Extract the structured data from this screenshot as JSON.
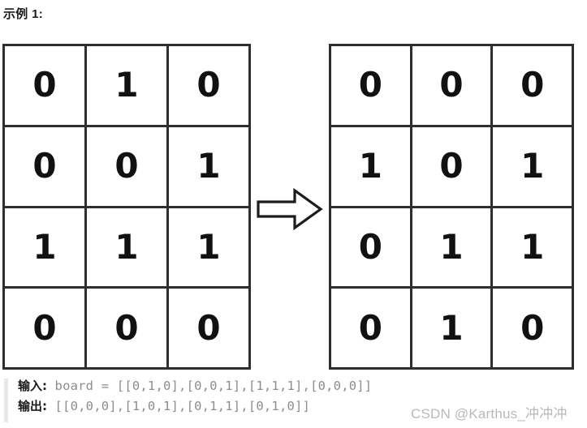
{
  "title": "示例 1:",
  "figure": {
    "arrow_label": "transforms-to",
    "input_grid": {
      "caption": "input-board",
      "rows": [
        [
          "0",
          "1",
          "0"
        ],
        [
          "0",
          "0",
          "1"
        ],
        [
          "1",
          "1",
          "1"
        ],
        [
          "0",
          "0",
          "0"
        ]
      ]
    },
    "output_grid": {
      "caption": "output-board",
      "rows": [
        [
          "0",
          "0",
          "0"
        ],
        [
          "1",
          "0",
          "1"
        ],
        [
          "0",
          "1",
          "1"
        ],
        [
          "0",
          "1",
          "0"
        ]
      ]
    }
  },
  "code_block": {
    "input_label": "输入:",
    "input_value": " board = [[0,1,0],[0,0,1],[1,1,1],[0,0,0]]",
    "output_label": "输出:",
    "output_value": " [[0,0,0],[1,0,1],[0,1,1],[0,1,0]]"
  },
  "watermark": "CSDN @Karthus_冲冲冲",
  "colors": {
    "grid_border": "#2e2e2e",
    "digit": "#111111",
    "code_text": "#8d8d8d",
    "label_text": "#1a1a1a",
    "watermark": "#b9b9b9",
    "quote_bar": "#e8e8e8",
    "background": "#ffffff"
  }
}
